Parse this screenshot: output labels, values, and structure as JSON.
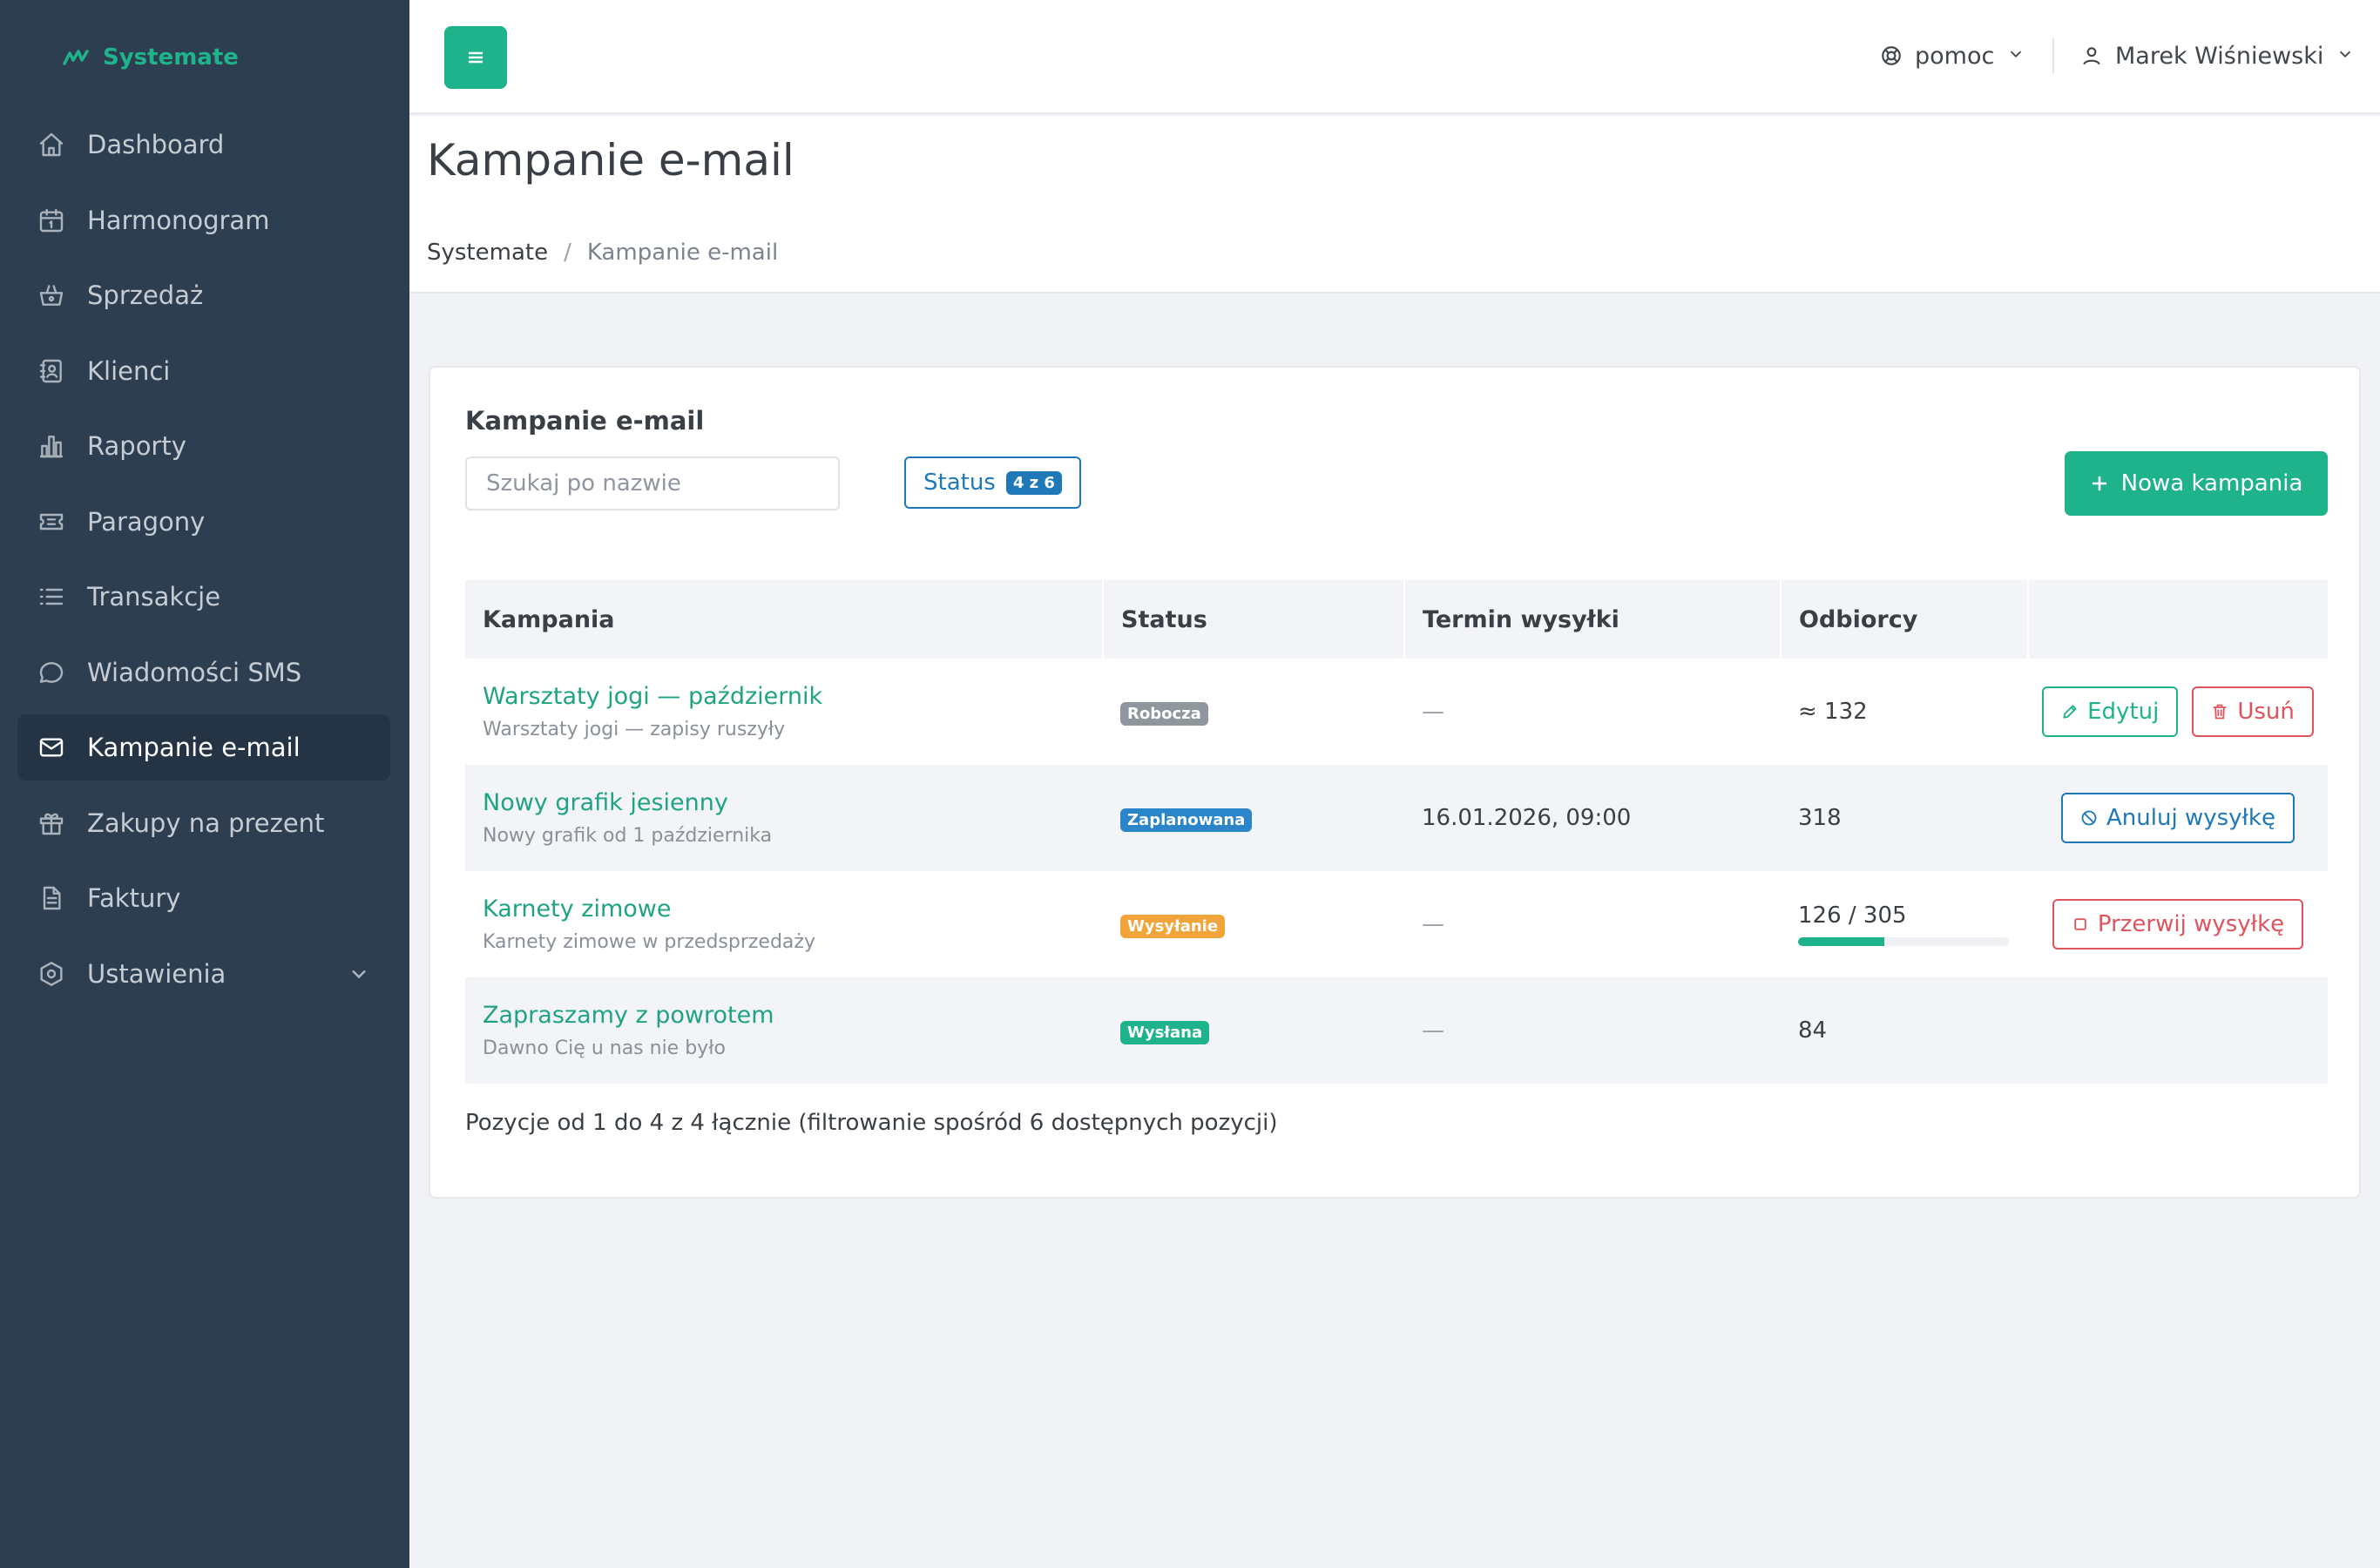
{
  "brand": {
    "name": "Systemate",
    "color": "#1fb38b"
  },
  "colors": {
    "accent": "#1fb38b",
    "sidebar": "#2d3e50",
    "blue": "#1f79b8",
    "danger": "#e0545e"
  },
  "sidebar": {
    "items": [
      {
        "label": "Dashboard",
        "icon": "home-icon"
      },
      {
        "label": "Harmonogram",
        "icon": "calendar-icon"
      },
      {
        "label": "Sprzedaż",
        "icon": "basket-icon"
      },
      {
        "label": "Klienci",
        "icon": "contacts-icon"
      },
      {
        "label": "Raporty",
        "icon": "bar-chart-icon"
      },
      {
        "label": "Paragony",
        "icon": "ticket-icon"
      },
      {
        "label": "Transakcje",
        "icon": "list-icon"
      },
      {
        "label": "Wiadomości SMS",
        "icon": "chat-icon"
      },
      {
        "label": "Kampanie e-mail",
        "icon": "mail-icon",
        "active": true
      },
      {
        "label": "Zakupy na prezent",
        "icon": "gift-icon"
      },
      {
        "label": "Faktury",
        "icon": "document-icon"
      },
      {
        "label": "Ustawienia",
        "icon": "settings-icon",
        "expandable": true
      }
    ]
  },
  "topbar": {
    "menu_icon": "hamburger-icon",
    "help_label": "pomoc",
    "user_name": "Marek Wiśniewski"
  },
  "page": {
    "title": "Kampanie e-mail",
    "breadcrumb": [
      "Systemate",
      "/",
      "Kampanie e-mail"
    ]
  },
  "card": {
    "title": "Kampanie e-mail",
    "search_placeholder": "Szukaj po nazwie",
    "status_filter_label": "Status",
    "status_filter_count": "4 z 6",
    "new_button_label": "Nowa kampania",
    "columns": [
      "Kampania",
      "Status",
      "Termin wysyłki",
      "Odbiorcy",
      ""
    ],
    "rows": [
      {
        "name": "Warsztaty jogi — październik",
        "subtitle": "Warsztaty jogi — zapisy ruszyły",
        "status": "Robocza",
        "status_color": "#8f969e",
        "date": "—",
        "recipients": "≈ 132",
        "actions": [
          "Edytuj",
          "Usuń"
        ]
      },
      {
        "name": "Nowy grafik jesienny",
        "subtitle": "Nowy grafik od 1 października",
        "status": "Zaplanowana",
        "status_color": "#2a86c8",
        "date": "16.01.2026, 09:00",
        "recipients": "318",
        "actions": [
          "Anuluj wysyłkę"
        ]
      },
      {
        "name": "Karnety zimowe",
        "subtitle": "Karnety zimowe w przedsprzedaży",
        "status": "Wysyłanie",
        "status_color": "#f0a43a",
        "date": "—",
        "recipients": "126 / 305",
        "progress": 0.41,
        "actions": [
          "Przerwij wysyłkę"
        ]
      },
      {
        "name": "Zapraszamy z powrotem",
        "subtitle": "Dawno Cię u nas nie było",
        "status": "Wysłana",
        "status_color": "#1fb38b",
        "date": "—",
        "recipients": "84",
        "actions": []
      }
    ],
    "footer": "Pozycje od 1 do 4 z 4 łącznie (filtrowanie spośród 6 dostępnych pozycji)"
  }
}
